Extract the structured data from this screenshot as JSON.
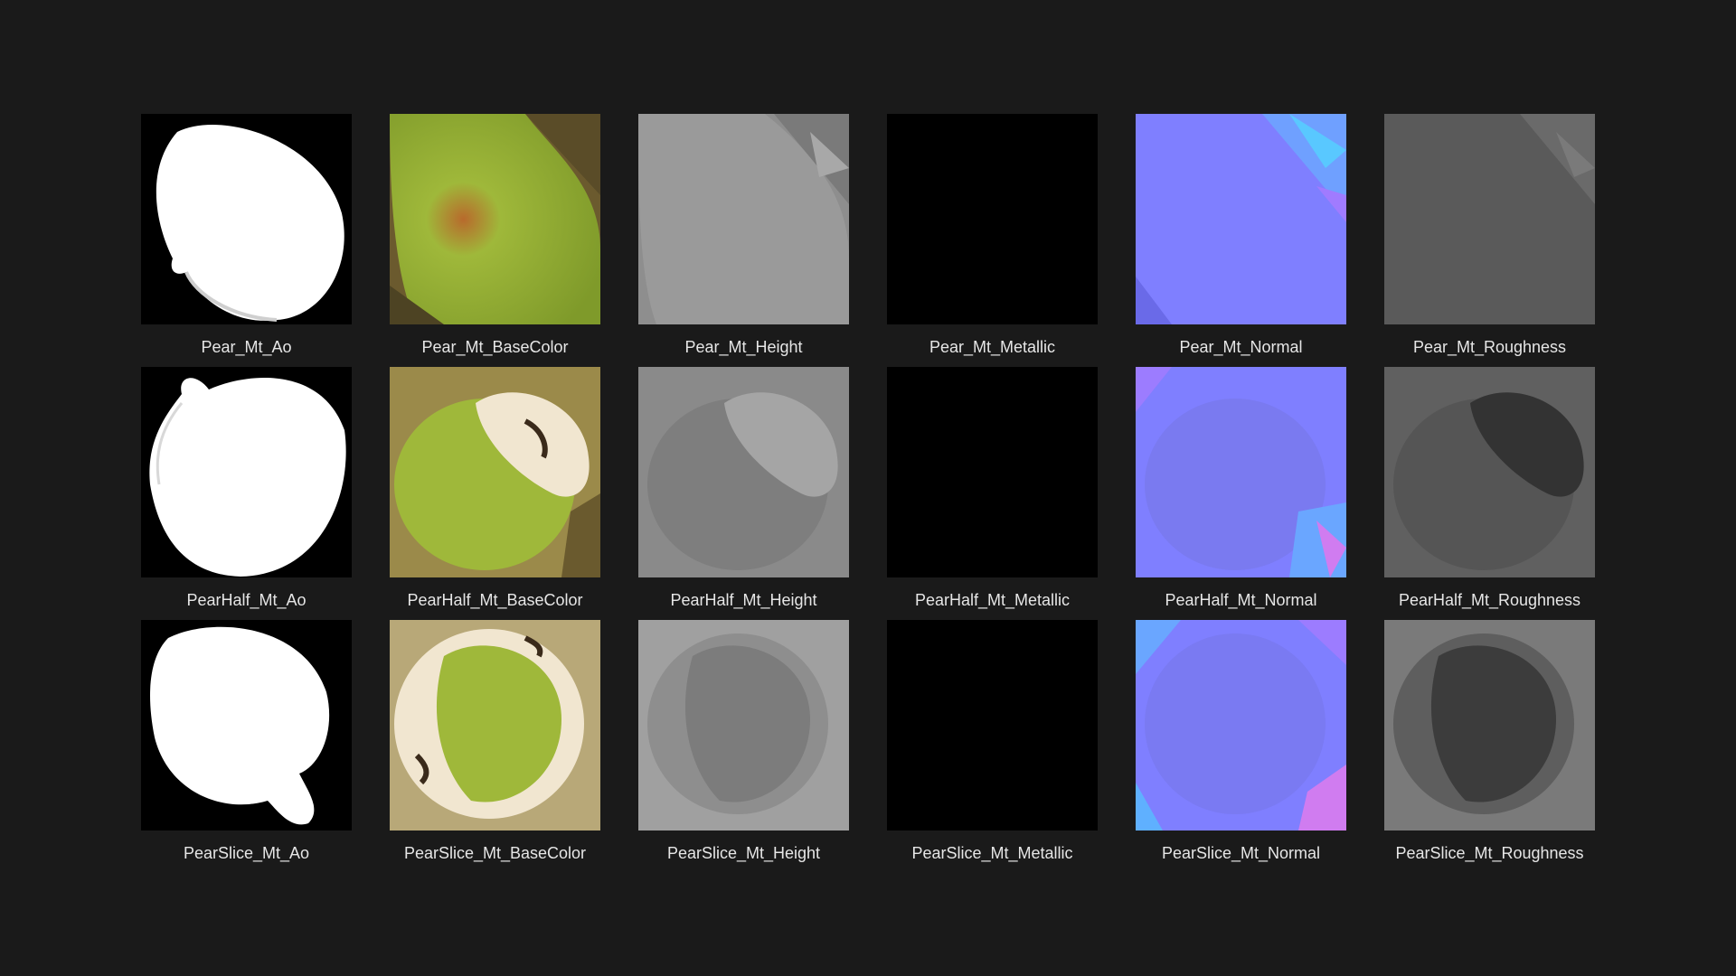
{
  "rows": [
    {
      "tiles": [
        {
          "name": "Pear_Mt_Ao",
          "map": "ao"
        },
        {
          "name": "Pear_Mt_BaseColor",
          "map": "basecolor"
        },
        {
          "name": "Pear_Mt_Height",
          "map": "height"
        },
        {
          "name": "Pear_Mt_Metallic",
          "map": "metallic"
        },
        {
          "name": "Pear_Mt_Normal",
          "map": "normal"
        },
        {
          "name": "Pear_Mt_Roughness",
          "map": "roughness"
        }
      ]
    },
    {
      "tiles": [
        {
          "name": "PearHalf_Mt_Ao",
          "map": "ao"
        },
        {
          "name": "PearHalf_Mt_BaseColor",
          "map": "basecolor"
        },
        {
          "name": "PearHalf_Mt_Height",
          "map": "height"
        },
        {
          "name": "PearHalf_Mt_Metallic",
          "map": "metallic"
        },
        {
          "name": "PearHalf_Mt_Normal",
          "map": "normal"
        },
        {
          "name": "PearHalf_Mt_Roughness",
          "map": "roughness"
        }
      ]
    },
    {
      "tiles": [
        {
          "name": "PearSlice_Mt_Ao",
          "map": "ao"
        },
        {
          "name": "PearSlice_Mt_BaseColor",
          "map": "basecolor"
        },
        {
          "name": "PearSlice_Mt_Height",
          "map": "height"
        },
        {
          "name": "PearSlice_Mt_Metallic",
          "map": "metallic"
        },
        {
          "name": "PearSlice_Mt_Normal",
          "map": "normal"
        },
        {
          "name": "PearSlice_Mt_Roughness",
          "map": "roughness"
        }
      ]
    }
  ],
  "colors": {
    "background": "#1a1a1a",
    "caption": "#e6e6e6",
    "normal_base": "#7f7fff",
    "basecolor_green": "#9fb83a",
    "height_gray": "#8a8a8a",
    "roughness_gray": "#5c5c5c",
    "metallic": "#000000",
    "ao_white": "#ffffff"
  }
}
